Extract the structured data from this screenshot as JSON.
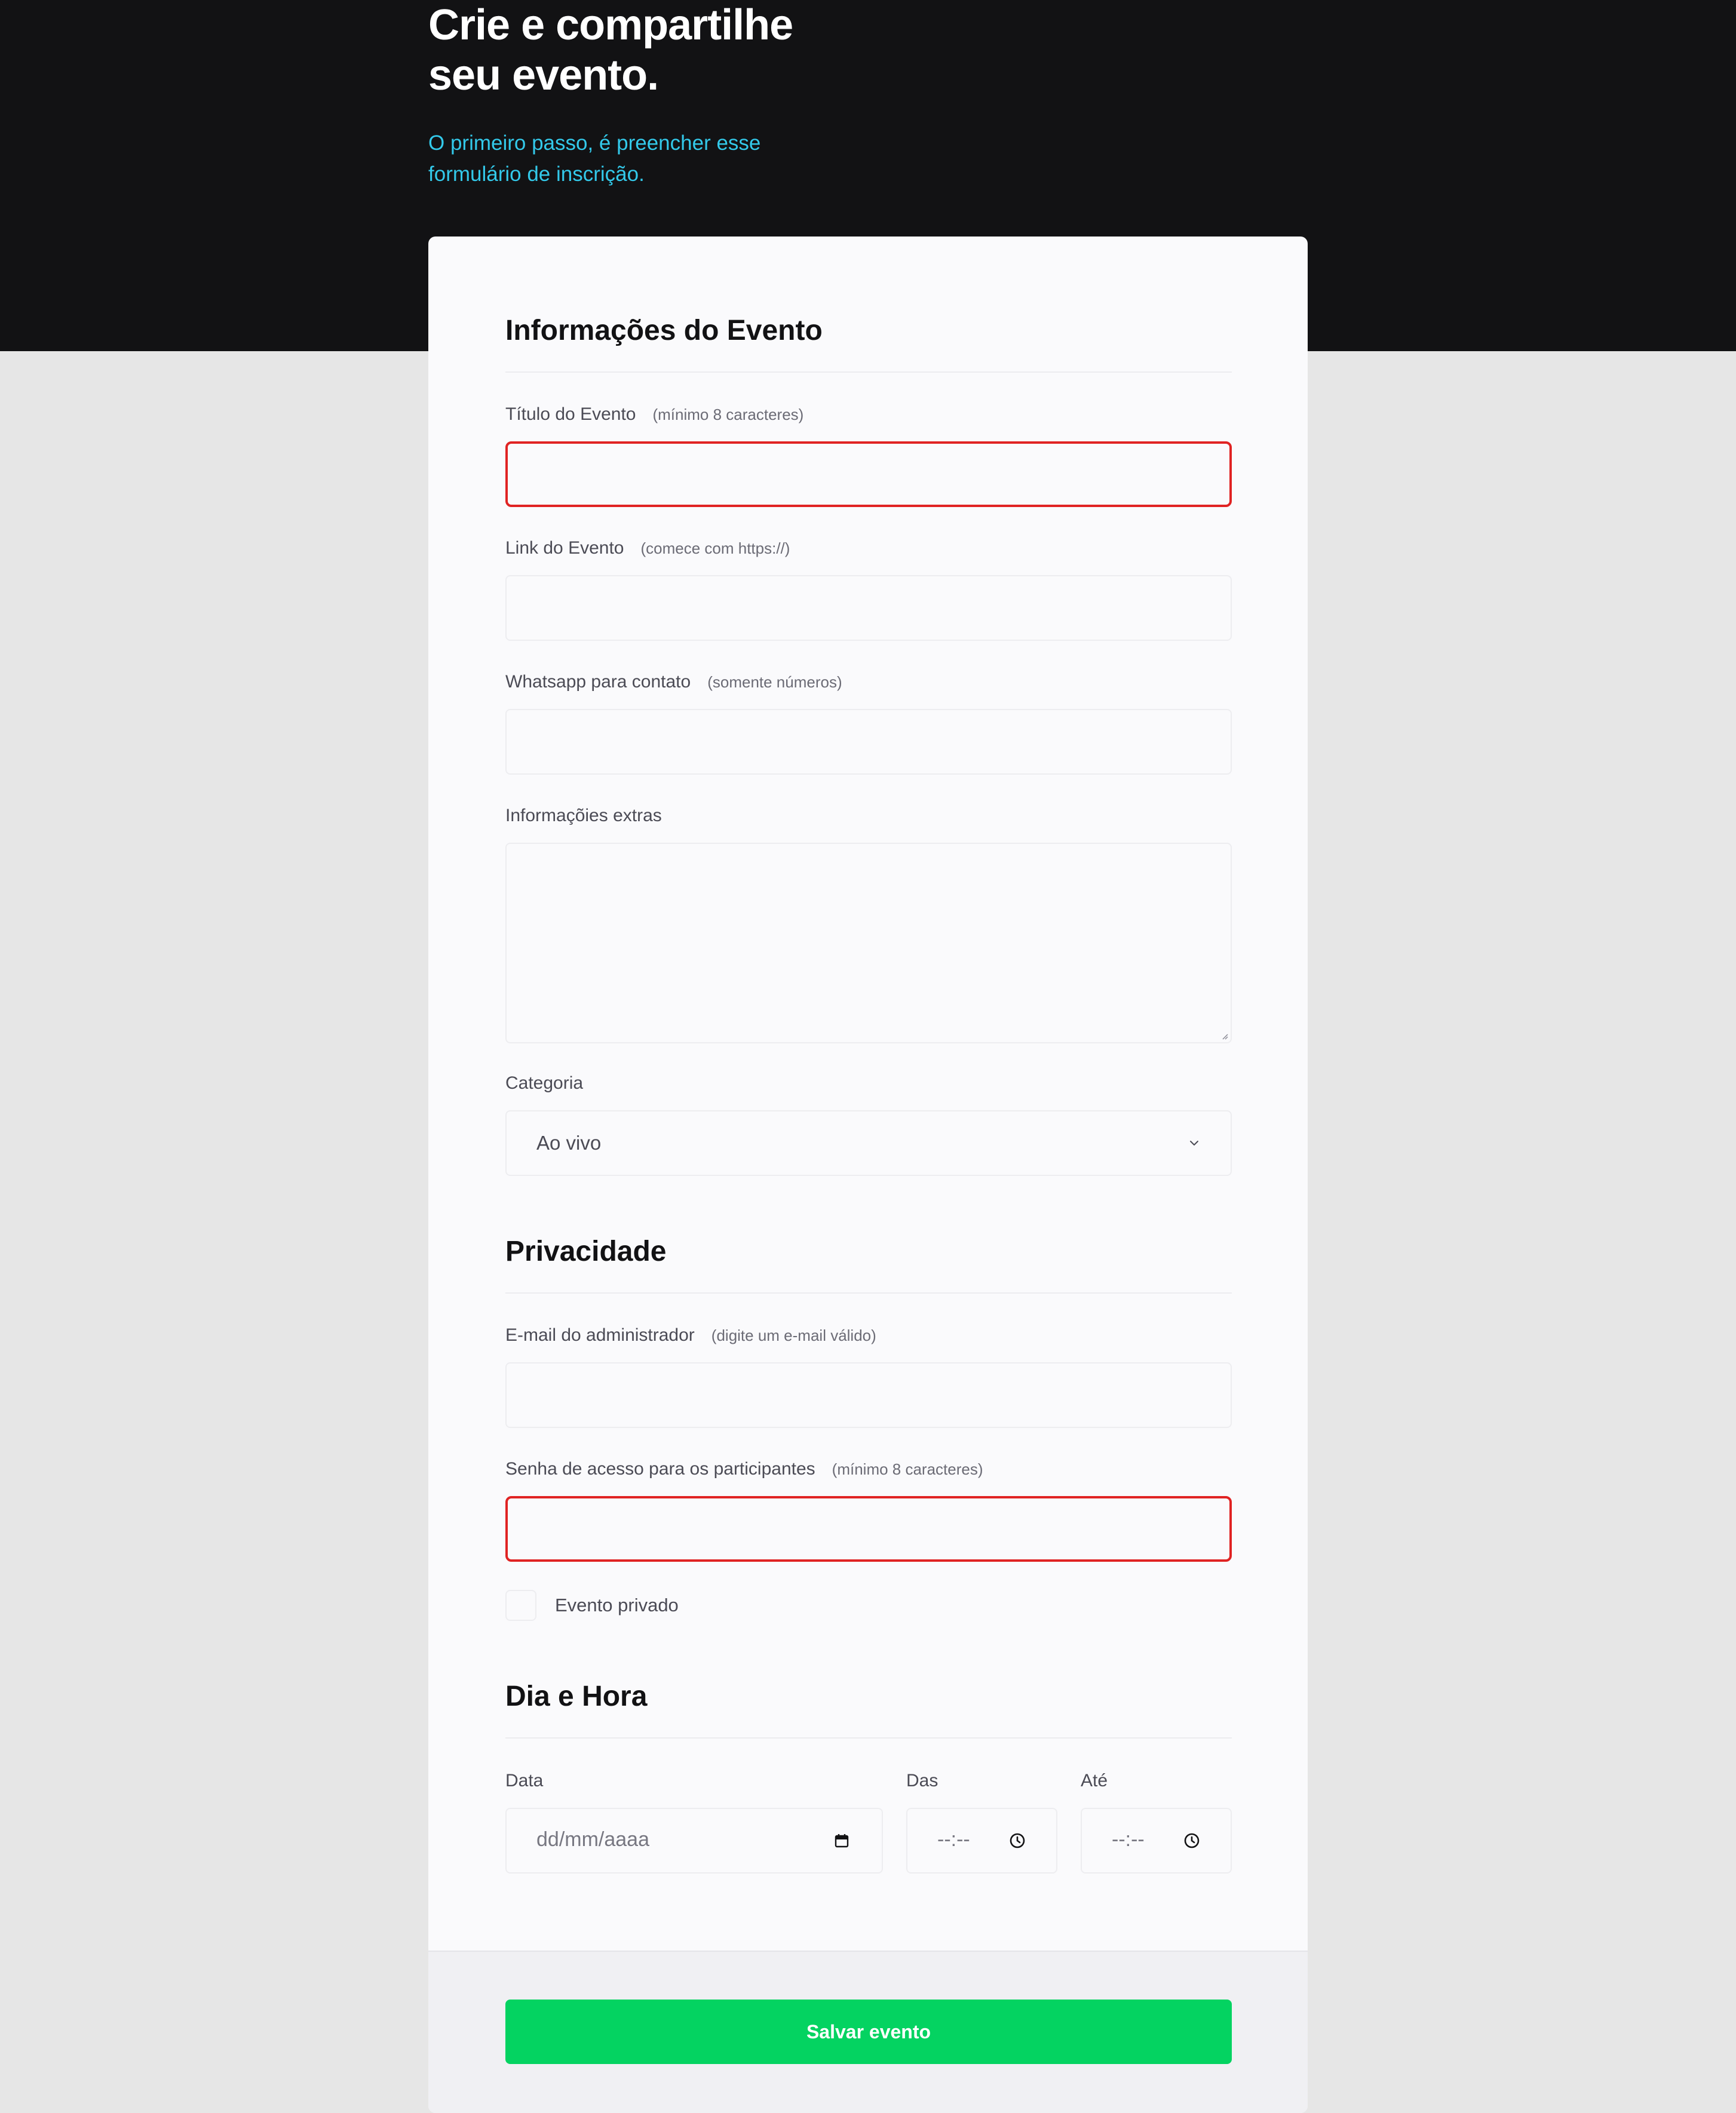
{
  "hero": {
    "title_line1": "Crie e compartilhe",
    "title_line2": "seu evento.",
    "subtitle_line1": "O primeiro passo, é preencher esse",
    "subtitle_line2": "formulário de inscrição."
  },
  "sections": {
    "event_info": "Informações do Evento",
    "privacy": "Privacidade",
    "datetime": "Dia e Hora"
  },
  "fields": {
    "title": {
      "label": "Título do Evento",
      "hint": "(mínimo 8 caracteres)",
      "value": "",
      "state": "error"
    },
    "link": {
      "label": "Link do Evento",
      "hint": "(comece com https://)",
      "value": ""
    },
    "whatsapp": {
      "label": "Whatsapp para contato",
      "hint": "(somente números)",
      "value": ""
    },
    "extra": {
      "label": "Informaçõies extras",
      "value": ""
    },
    "category": {
      "label": "Categoria",
      "selected": "Ao vivo"
    },
    "admin_email": {
      "label": "E-mail do administrador",
      "hint": "(digite um e-mail válido)",
      "value": ""
    },
    "password": {
      "label": "Senha de acesso para os participantes",
      "hint": "(mínimo 8 caracteres)",
      "value": "",
      "state": "error"
    },
    "private_event": {
      "label": "Evento privado",
      "checked": false
    },
    "date": {
      "label": "Data",
      "placeholder": "dd/mm/aaaa"
    },
    "time_from": {
      "label": "Das",
      "placeholder": "--:--"
    },
    "time_to": {
      "label": "Até",
      "placeholder": "--:--"
    }
  },
  "actions": {
    "save_label": "Salvar evento"
  },
  "colors": {
    "hero_bg": "#121214",
    "accent_cyan": "#33c9ea",
    "error_border": "#e02323",
    "save_green": "#04d361",
    "page_bg": "#e6e6e6"
  },
  "icons": [
    "chevron-down-icon",
    "calendar-icon",
    "clock-icon"
  ]
}
